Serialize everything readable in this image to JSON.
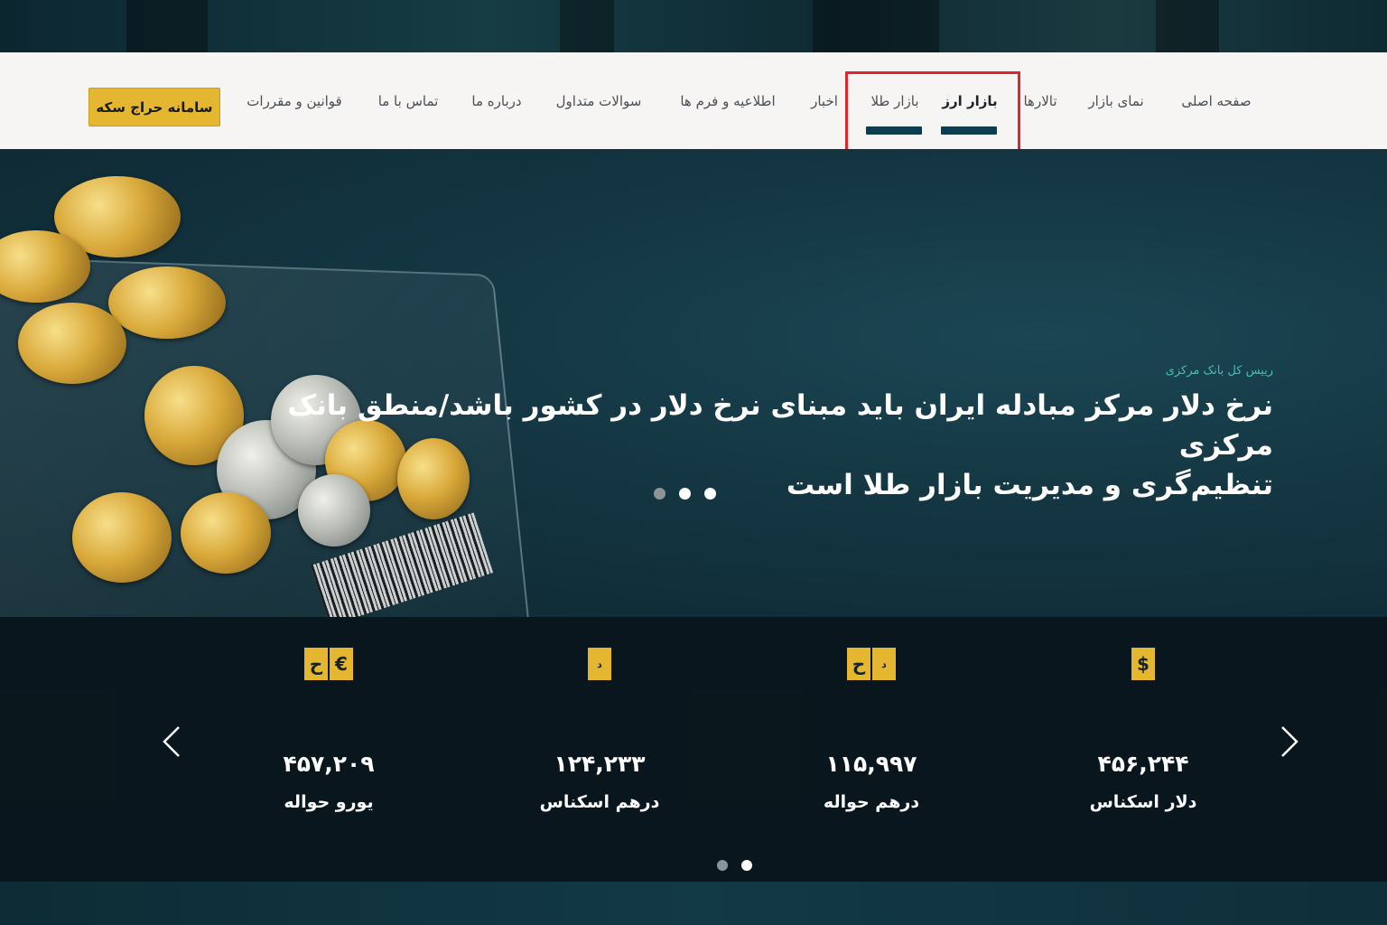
{
  "nav": {
    "items": [
      {
        "label": "صفحه اصلی"
      },
      {
        "label": "نمای بازار"
      },
      {
        "label": "تالارها"
      },
      {
        "label": "بازار ارز"
      },
      {
        "label": "بازار طلا"
      },
      {
        "label": "اخبار"
      },
      {
        "label": "اطلاعیه و فرم ها"
      },
      {
        "label": "سوالات متداول"
      },
      {
        "label": "درباره ما"
      },
      {
        "label": "تماس با ما"
      },
      {
        "label": "قوانین و مقررات"
      }
    ],
    "active": "بازار ارز",
    "auction_button": "سامانه حراج سکه"
  },
  "hero": {
    "subtitle": "رییس کل بانک مرکزی",
    "title_line1": "نرخ دلار مرکز مبادله ایران باید مبنای نرخ دلار در کشور باشد/منطق بانک مرکزی",
    "title_line2": "تنظیم‌گری و مدیریت بازار طلا است",
    "slides": 3,
    "active_slide": 2
  },
  "rates": [
    {
      "name": "دلار اسکناس",
      "value": "۴۵۶,۲۴۴",
      "icon": "dollar-icon"
    },
    {
      "name": "درهم حواله",
      "value": "۱۱۵,۹۹۷",
      "icon": "dirham-transfer-icon"
    },
    {
      "name": "درهم اسکناس",
      "value": "۱۲۴,۲۳۳",
      "icon": "dirham-icon"
    },
    {
      "name": "یورو حواله",
      "value": "۴۵۷,۲۰۹",
      "icon": "euro-transfer-icon"
    }
  ],
  "rates_pages": 2,
  "rates_active_page": 1,
  "colors": {
    "accent_gold": "#e5b730",
    "underline": "#0e3d4d",
    "highlight": "#e0262c",
    "subtitle": "#43c0b4"
  }
}
